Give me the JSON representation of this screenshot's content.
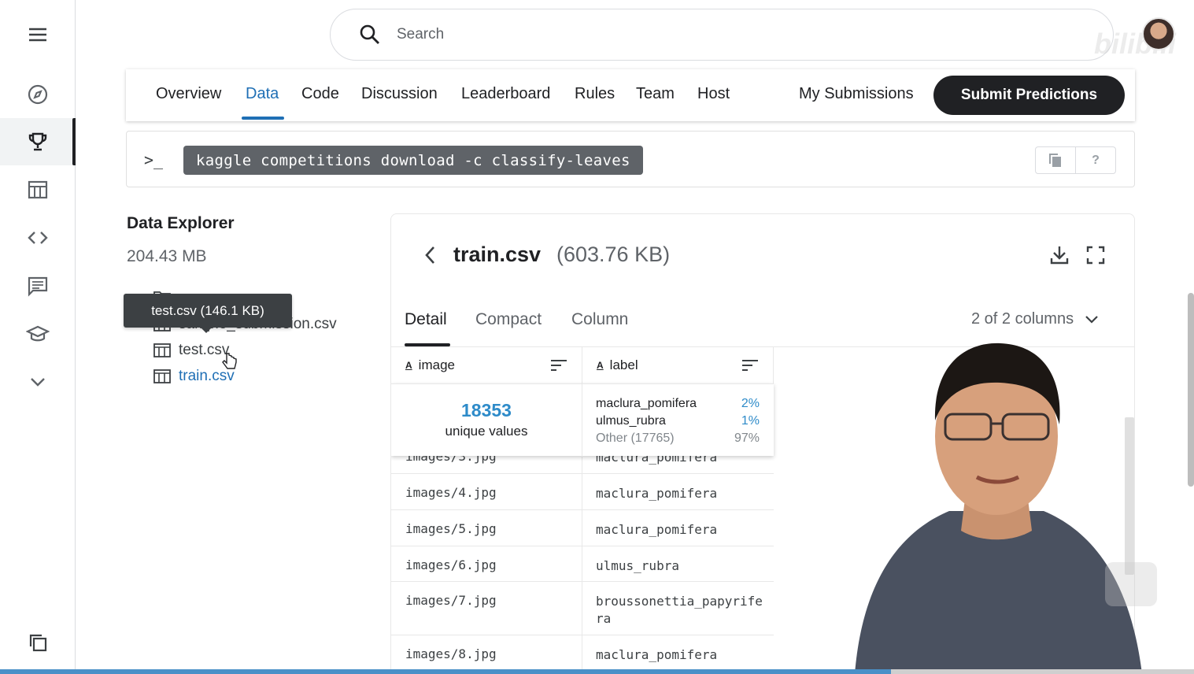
{
  "search": {
    "placeholder": "Search"
  },
  "nav": {
    "tabs": [
      "Overview",
      "Data",
      "Code",
      "Discussion",
      "Leaderboard",
      "Rules",
      "Team",
      "Host"
    ],
    "active_tab": "Data",
    "my_submissions": "My Submissions",
    "submit": "Submit Predictions"
  },
  "command": {
    "prompt": ">_",
    "text": "kaggle competitions download -c classify-leaves",
    "help": "?"
  },
  "explorer": {
    "title": "Data Explorer",
    "size": "204.43 MB",
    "files": [
      "sample_submission.csv",
      "test.csv",
      "train.csv"
    ],
    "active_file": "train.csv",
    "tooltip": "test.csv (146.1 KB)"
  },
  "file": {
    "name": "train.csv",
    "size": "(603.76 KB)",
    "tabs": [
      "Detail",
      "Compact",
      "Column"
    ],
    "active_tab": "Detail",
    "columns_selector": "2 of 2 columns",
    "columns": [
      {
        "type": "A",
        "name": "image"
      },
      {
        "type": "A",
        "name": "label"
      }
    ],
    "summary": {
      "unique_count": "18353",
      "unique_label": "unique values",
      "top": [
        {
          "value": "maclura_pomifera",
          "pct": "2%"
        },
        {
          "value": "ulmus_rubra",
          "pct": "1%"
        },
        {
          "value": "Other (17765)",
          "pct": "97%"
        }
      ]
    },
    "rows": [
      {
        "image": "images/3.jpg",
        "label": "maclura_pomifera"
      },
      {
        "image": "images/4.jpg",
        "label": "maclura_pomifera"
      },
      {
        "image": "images/5.jpg",
        "label": "maclura_pomifera"
      },
      {
        "image": "images/6.jpg",
        "label": "ulmus_rubra"
      },
      {
        "image": "images/7.jpg",
        "label": "broussonettia_papyrifera"
      },
      {
        "image": "images/8.jpg",
        "label": "maclura_pomifera"
      }
    ]
  },
  "colors": {
    "accent": "#1f6fb5",
    "stat": "#2e8bc9",
    "dark": "#202124"
  },
  "watermark": "bilibili"
}
